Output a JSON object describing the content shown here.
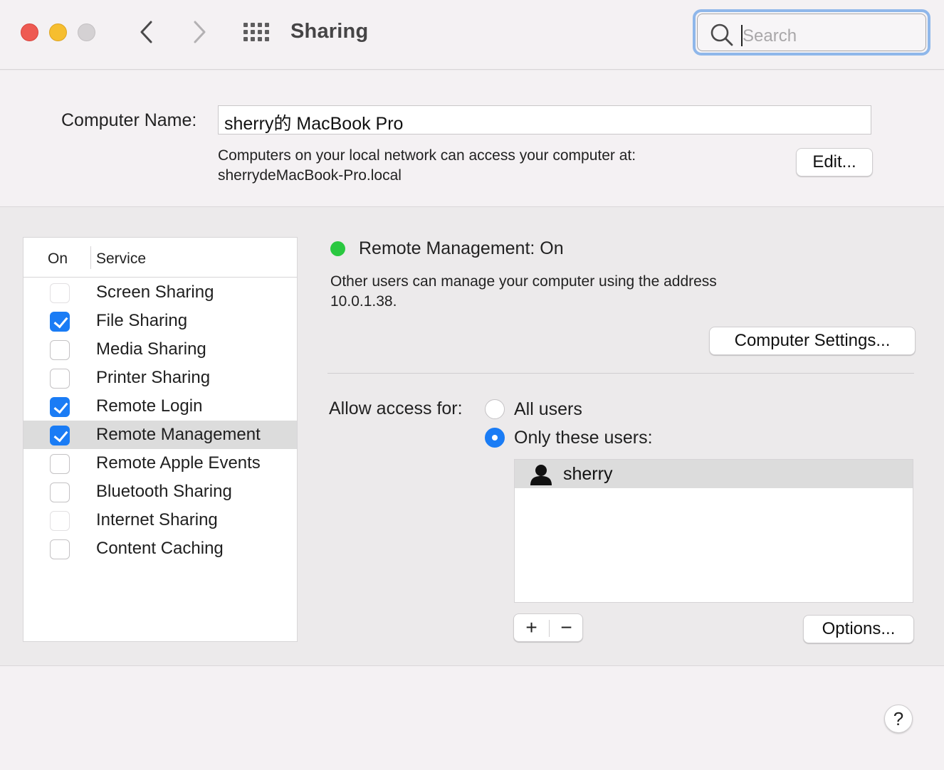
{
  "window": {
    "title": "Sharing",
    "search_placeholder": "Search"
  },
  "computer_name": {
    "label": "Computer Name:",
    "value": "sherry的 MacBook Pro",
    "network_line1": "Computers on your local network can access your computer at:",
    "network_line2": "sherrydeMacBook-Pro.local",
    "edit_button": "Edit..."
  },
  "services": {
    "header_on": "On",
    "header_service": "Service",
    "items": [
      {
        "label": "Screen Sharing",
        "checked": false,
        "dim": true
      },
      {
        "label": "File Sharing",
        "checked": true
      },
      {
        "label": "Media Sharing",
        "checked": false
      },
      {
        "label": "Printer Sharing",
        "checked": false
      },
      {
        "label": "Remote Login",
        "checked": true
      },
      {
        "label": "Remote Management",
        "checked": true,
        "selected": true
      },
      {
        "label": "Remote Apple Events",
        "checked": false
      },
      {
        "label": "Bluetooth Sharing",
        "checked": false
      },
      {
        "label": "Internet Sharing",
        "checked": false,
        "dim": true
      },
      {
        "label": "Content Caching",
        "checked": false
      }
    ]
  },
  "detail": {
    "status": "Remote Management: On",
    "status_color": "#2ac840",
    "description_line1": "Other users can manage your computer using the address",
    "description_line2": "10.0.1.38.",
    "computer_settings_button": "Computer Settings...",
    "allow_access_label": "Allow access for:",
    "option_all": "All users",
    "option_only": "Only these users:",
    "selected_option": "only",
    "users": [
      "sherry"
    ],
    "add_symbol": "+",
    "remove_symbol": "−",
    "options_button": "Options..."
  },
  "help_symbol": "?",
  "colors": {
    "accent": "#1a7cf5",
    "search_focus_ring": "#8fb7ea"
  }
}
